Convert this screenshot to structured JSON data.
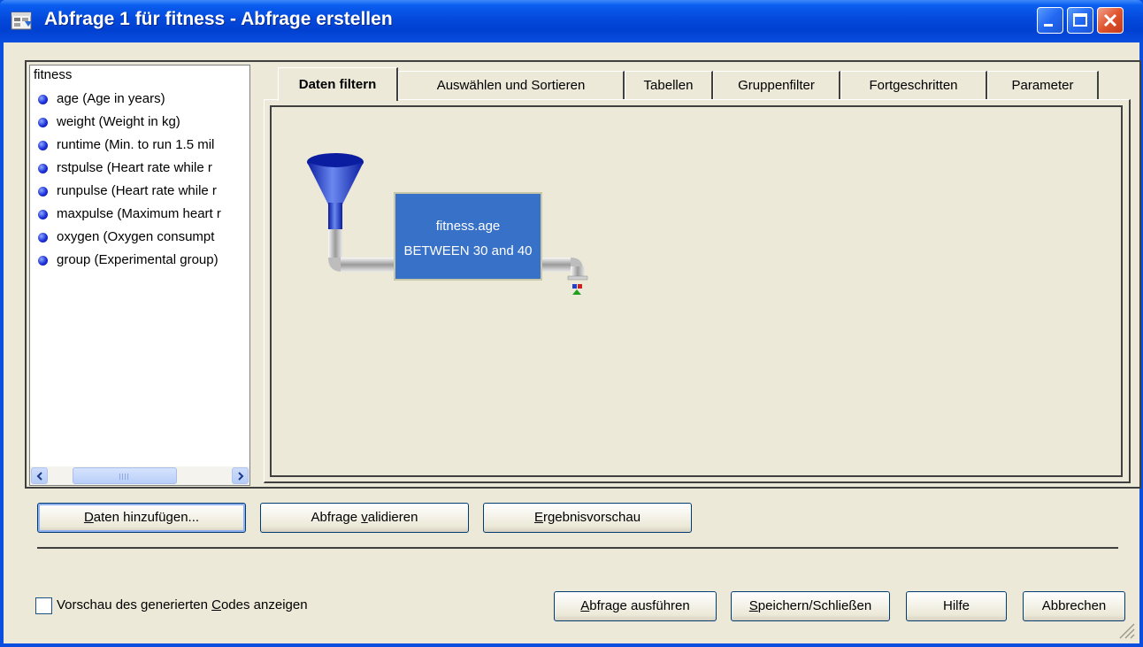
{
  "window": {
    "title": "Abfrage 1 für fitness - Abfrage erstellen",
    "frame_color": "#0a4ee0",
    "client_color": "#ece9d8"
  },
  "field_list": {
    "table_name": "fitness",
    "items": [
      {
        "label": "age (Age in years)"
      },
      {
        "label": "weight (Weight in kg)"
      },
      {
        "label": "runtime (Min. to run 1.5 mil"
      },
      {
        "label": "rstpulse (Heart rate while r"
      },
      {
        "label": "runpulse (Heart rate while r"
      },
      {
        "label": "maxpulse (Maximum heart r"
      },
      {
        "label": "oxygen (Oxygen consumpt"
      },
      {
        "label": "group (Experimental group)"
      }
    ]
  },
  "tabs": [
    {
      "label": "Daten filtern",
      "active": true
    },
    {
      "label": "Auswählen und Sortieren",
      "active": false
    },
    {
      "label": "Tabellen",
      "active": false
    },
    {
      "label": "Gruppenfilter",
      "active": false
    },
    {
      "label": "Fortgeschritten",
      "active": false
    },
    {
      "label": "Parameter",
      "active": false
    }
  ],
  "filter": {
    "line1": "fitness.age",
    "line2": "BETWEEN 30 and 40",
    "box_color": "#3771c8"
  },
  "buttons_top": {
    "add_data": {
      "pre": "",
      "acc": "D",
      "post": "aten hinzufügen..."
    },
    "validate": {
      "pre": "Abfrage ",
      "acc": "v",
      "post": "alidieren"
    },
    "preview": {
      "pre": "",
      "acc": "E",
      "post": "rgebnisvorschau"
    }
  },
  "preview_checkbox": {
    "pre": "Vorschau des generierten ",
    "acc": "C",
    "post": "odes anzeigen",
    "checked": false
  },
  "buttons_bottom": {
    "run": {
      "pre": "",
      "acc": "A",
      "post": "bfrage ausführen"
    },
    "save_close": {
      "pre": "",
      "acc": "S",
      "post": "peichern/Schließen"
    },
    "help": {
      "label": "Hilfe"
    },
    "cancel": {
      "label": "Abbrechen"
    }
  }
}
